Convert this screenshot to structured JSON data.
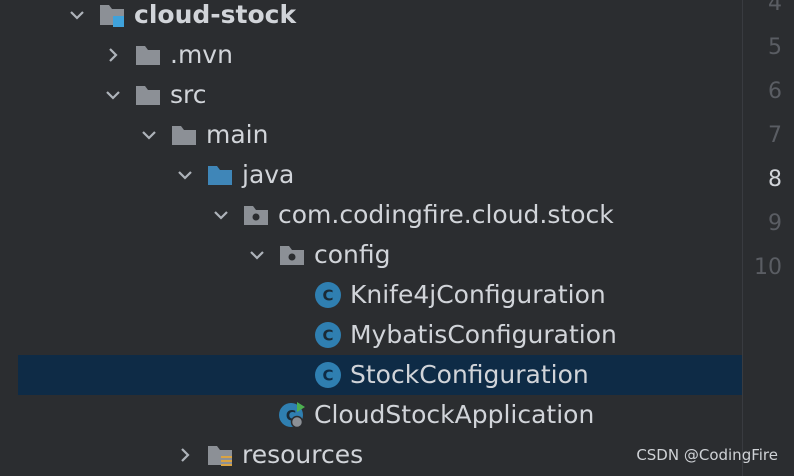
{
  "tree": {
    "project": "cloud-stock",
    "mvn": ".mvn",
    "src": "src",
    "main": "main",
    "java": "java",
    "package": "com.codingfire.cloud.stock",
    "config": "config",
    "knife4j": "Knife4jConfiguration",
    "mybatis": "MybatisConfiguration",
    "stock": "StockConfiguration",
    "app": "CloudStockApplication",
    "resources": "resources"
  },
  "gutter": {
    "lines": [
      "4",
      "5",
      "6",
      "7",
      "8",
      "9",
      "10"
    ],
    "current": "8"
  },
  "watermark": "CSDN @CodingFire",
  "colors": {
    "background": "#2b2d30",
    "selection": "#0e2b46",
    "folder": "#8c9096",
    "source_folder": "#3f86b8",
    "class_icon": "#2f7fb1",
    "run_badge": "#4caf50"
  }
}
